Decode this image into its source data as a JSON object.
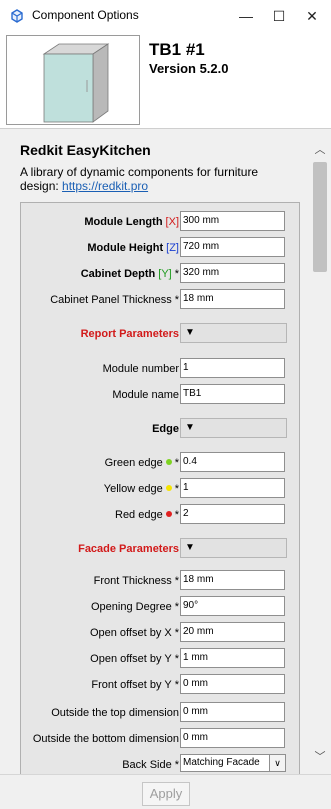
{
  "window": {
    "title": "Component Options",
    "minimize_glyph": "—",
    "maximize_glyph": "☐",
    "close_glyph": "✕"
  },
  "component": {
    "name": "TB1 #1",
    "version": "Version 5.2.0"
  },
  "brand": {
    "title": "Redkit EasyKitchen",
    "description": "A library of dynamic components for furniture design: ",
    "link": "https://redkit.pro"
  },
  "fields": [
    {
      "type": "input",
      "label": "Module Length",
      "tag": "[X]",
      "tag_color": "#d21a1a",
      "bold": true,
      "star": "",
      "value": "300 mm"
    },
    {
      "type": "input",
      "label": "Module Height",
      "tag": "[Z]",
      "tag_color": "#1b3fd0",
      "bold": true,
      "star": "",
      "value": "720 mm"
    },
    {
      "type": "input",
      "label": "Cabinet Depth",
      "tag": "[Y]",
      "tag_color": "#1e9a1e",
      "bold": true,
      "star": "*",
      "value": "320 mm"
    },
    {
      "type": "input",
      "label": "Cabinet Panel Thickness",
      "tag": "",
      "bold": false,
      "star": "*",
      "value": "18 mm"
    },
    {
      "type": "section",
      "label": "Report Parameters",
      "style": "red",
      "toggle": "▼"
    },
    {
      "type": "input",
      "label": "Module number",
      "tag": "",
      "bold": false,
      "star": "",
      "value": "1"
    },
    {
      "type": "input",
      "label": "Module name",
      "tag": "",
      "bold": false,
      "star": "",
      "value": "TB1"
    },
    {
      "type": "section",
      "label": "Edge",
      "style": "bold",
      "toggle": "▼"
    },
    {
      "type": "input",
      "label": "Green edge",
      "dot": "#7ed321",
      "bold": false,
      "star": "*",
      "value": "0.4"
    },
    {
      "type": "input",
      "label": "Yellow edge",
      "dot": "#f5e400",
      "bold": false,
      "star": "*",
      "value": "1"
    },
    {
      "type": "input",
      "label": "Red edge",
      "dot": "#e02020",
      "bold": false,
      "star": "*",
      "value": "2"
    },
    {
      "type": "section",
      "label": "Facade Parameters",
      "style": "red",
      "toggle": "▼"
    },
    {
      "type": "input",
      "label": "Front Thickness",
      "bold": false,
      "star": "*",
      "value": "18 mm"
    },
    {
      "type": "input",
      "label": "Opening Degree",
      "bold": false,
      "star": "*",
      "value": "90°"
    },
    {
      "type": "input",
      "label": "Open offset by X",
      "bold": false,
      "star": "*",
      "value": "20 mm"
    },
    {
      "type": "input",
      "label": "Open offset by Y",
      "bold": false,
      "star": "*",
      "value": "1 mm"
    },
    {
      "type": "input",
      "label": "Front offset by Y",
      "bold": false,
      "star": "*",
      "value": "0 mm"
    },
    {
      "type": "input",
      "label": "Outside the top dimension",
      "bold": false,
      "star": "",
      "value": "0 mm"
    },
    {
      "type": "input",
      "label": "Outside the bottom dimension",
      "bold": false,
      "star": "",
      "value": "0 mm"
    },
    {
      "type": "select",
      "label": "Back Side",
      "bold": false,
      "star": "*",
      "value": "Matching Facade"
    }
  ],
  "scrollbar": {
    "up": "︿",
    "down": "﹀"
  },
  "footer": {
    "apply_label": "Apply"
  }
}
